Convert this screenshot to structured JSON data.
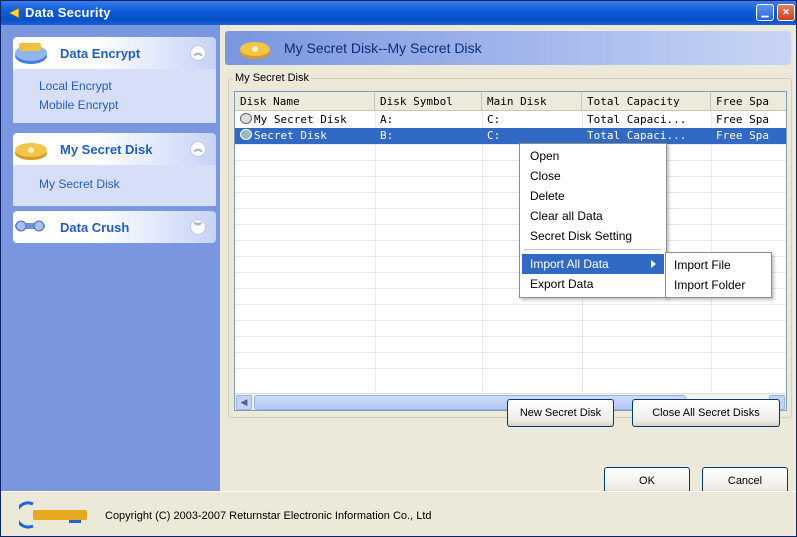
{
  "window": {
    "title": "Data Security"
  },
  "sidebar": {
    "panels": [
      {
        "label": "Data Encrypt",
        "items": [
          "Local Encrypt",
          "Mobile Encrypt"
        ],
        "expanded": true
      },
      {
        "label": "My Secret Disk",
        "items": [
          "My Secret Disk"
        ],
        "expanded": true
      },
      {
        "label": "Data Crush",
        "items": [],
        "expanded": false
      }
    ]
  },
  "main": {
    "header_title": "My Secret Disk--My Secret Disk",
    "group_label": "My Secret Disk",
    "list": {
      "columns": [
        "Disk Name",
        "Disk Symbol",
        "Main Disk",
        "Total Capacity",
        "Free Spa"
      ],
      "rows": [
        {
          "cells": [
            "My Secret Disk",
            "A:",
            "C:",
            "Total Capaci...",
            "Free Spa"
          ],
          "selected": false
        },
        {
          "cells": [
            "Secret Disk",
            "B:",
            "C:",
            "Total Capaci...",
            "Free Spa"
          ],
          "selected": true
        }
      ]
    },
    "buttons": {
      "new_secret_disk": "New Secret Disk",
      "close_all": "Close All Secret Disks",
      "ok": "OK",
      "cancel": "Cancel"
    }
  },
  "context_menu": {
    "items": [
      "Open",
      "Close",
      "Delete",
      "Clear all Data",
      "Secret Disk Setting",
      "Import All Data",
      "Export Data"
    ],
    "active": "Import All Data",
    "submenu": [
      "Import File",
      "Import Folder"
    ]
  },
  "footer": {
    "copyright": "Copyright (C) 2003-2007 Returnstar Electronic Information Co., Ltd"
  },
  "colors": {
    "titlebar": "#0a5ad8",
    "sidebar": "#7a96df",
    "selection": "#316ac5",
    "link": "#215dc6"
  }
}
